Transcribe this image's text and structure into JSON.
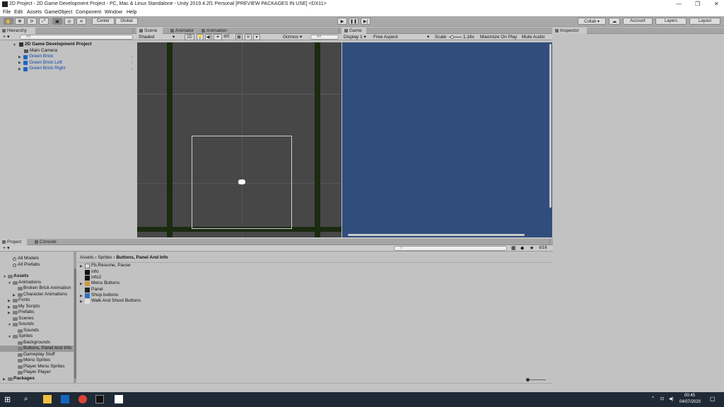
{
  "window": {
    "title": "2D Project - 2D Game Development Project - PC, Mac & Linux Standalone - Unity 2019.4.2f1 Personal [PREVIEW PACKAGES IN USE] <DX11>",
    "controls": [
      "—",
      "❐",
      "✕"
    ]
  },
  "menu": [
    "File",
    "Edit",
    "Assets",
    "GameObject",
    "Component",
    "Window",
    "Help"
  ],
  "toolbar": {
    "pivot": "Center",
    "space": "Global",
    "collab": "Collab ▾",
    "account": "Account",
    "layers": "Layers",
    "layout": "Layout"
  },
  "hierarchy": {
    "tab": "Hierarchy",
    "add": "+ ▾",
    "search_placeholder": "All",
    "scene_name": "2D Game Development Project",
    "items": [
      "Main Camera",
      "Green Brick",
      "Green Brick Left",
      "Green Brick Right"
    ]
  },
  "scene": {
    "tabs": [
      "Scene",
      "Animator",
      "Animation"
    ],
    "shading": "Shaded",
    "mode_2d": "2D",
    "fx_count": "0",
    "gizmos": "Gizmos",
    "search_placeholder": "All"
  },
  "game": {
    "tab": "Game",
    "display": "Display 1",
    "aspect": "Free Aspect",
    "scale_label": "Scale",
    "scale_value": "1.16x",
    "maximize": "Maximize On Play",
    "mute": "Mute Audio"
  },
  "inspector": {
    "tab": "Inspector"
  },
  "project": {
    "tabs": [
      "Project",
      "Console"
    ],
    "add": "+ ▾",
    "hidden_count": "16",
    "tree": [
      {
        "label": "All Models",
        "indent": 1
      },
      {
        "label": "All Prefabs",
        "indent": 1
      },
      {
        "label": "Assets",
        "indent": 0,
        "bold": true
      },
      {
        "label": "Animations",
        "indent": 1
      },
      {
        "label": "Broken Brick Animation",
        "indent": 2
      },
      {
        "label": "Character Animations",
        "indent": 2
      },
      {
        "label": "Fonts",
        "indent": 1
      },
      {
        "label": "My Scripts",
        "indent": 1
      },
      {
        "label": "Prefabs",
        "indent": 1
      },
      {
        "label": "Scenes",
        "indent": 1
      },
      {
        "label": "Sounds",
        "indent": 1
      },
      {
        "label": "Sounds",
        "indent": 2
      },
      {
        "label": "Sprites",
        "indent": 1
      },
      {
        "label": "Backgrounds",
        "indent": 2
      },
      {
        "label": "Buttons, Panel And Info",
        "indent": 2,
        "selected": true
      },
      {
        "label": "Gameplay Stuff",
        "indent": 2
      },
      {
        "label": "Menu Sprites",
        "indent": 2
      },
      {
        "label": "Player Menu Sprites",
        "indent": 2
      },
      {
        "label": "Player Player",
        "indent": 2
      },
      {
        "label": "Packages",
        "indent": 0,
        "bold": true
      }
    ],
    "breadcrumb": [
      "Assets",
      "Sprites",
      "Buttons, Panel And Info"
    ],
    "files": [
      "Fb,Resume, Pause",
      "info",
      "info2",
      "Menu Buttons",
      "Panel",
      "Shop buttons",
      "Walk And Shoot Buttons"
    ]
  },
  "taskbar": {
    "time": "00:45",
    "date": "04/07/2020"
  },
  "colors": {
    "game_bg": "#314d7c",
    "scene_bg": "#474747",
    "taskbar": "#1f2a36"
  }
}
